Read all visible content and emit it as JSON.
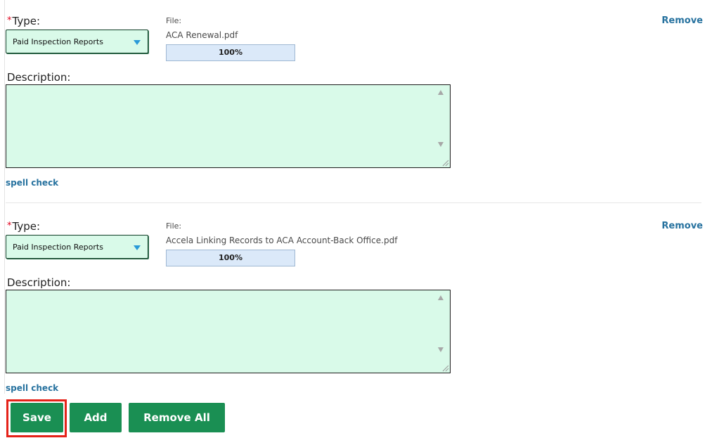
{
  "documents": [
    {
      "type_label": "Type:",
      "required_marker": "*",
      "type_value": "Paid Inspection Reports",
      "file_label": "File:",
      "file_name": "ACA Renewal.pdf",
      "progress_text": "100%",
      "progress_fraction": 1.0,
      "remove_label": "Remove",
      "description_label": "Description:",
      "description_value": "",
      "spell_check_label": "spell check"
    },
    {
      "type_label": "Type:",
      "required_marker": "*",
      "type_value": "Paid Inspection Reports",
      "file_label": "File:",
      "file_name": "Accela Linking Records to ACA Account-Back Office.pdf",
      "progress_text": "100%",
      "progress_fraction": 1.0,
      "remove_label": "Remove",
      "description_label": "Description:",
      "description_value": "",
      "spell_check_label": "spell check"
    }
  ],
  "actions": {
    "save_label": "Save",
    "add_label": "Add",
    "remove_all_label": "Remove All",
    "highlighted_button": "Save"
  },
  "colors": {
    "button_green": "#1a8f53",
    "field_background": "#d9fae9",
    "link_blue": "#27729f",
    "required_red": "#e0001b",
    "highlight_red": "#e52219"
  },
  "icons": {
    "dropdown": "chevron-down-icon",
    "scroll_up": "scroll-up-arrow-icon",
    "scroll_down": "scroll-down-arrow-icon",
    "resize": "resize-grip-icon"
  }
}
